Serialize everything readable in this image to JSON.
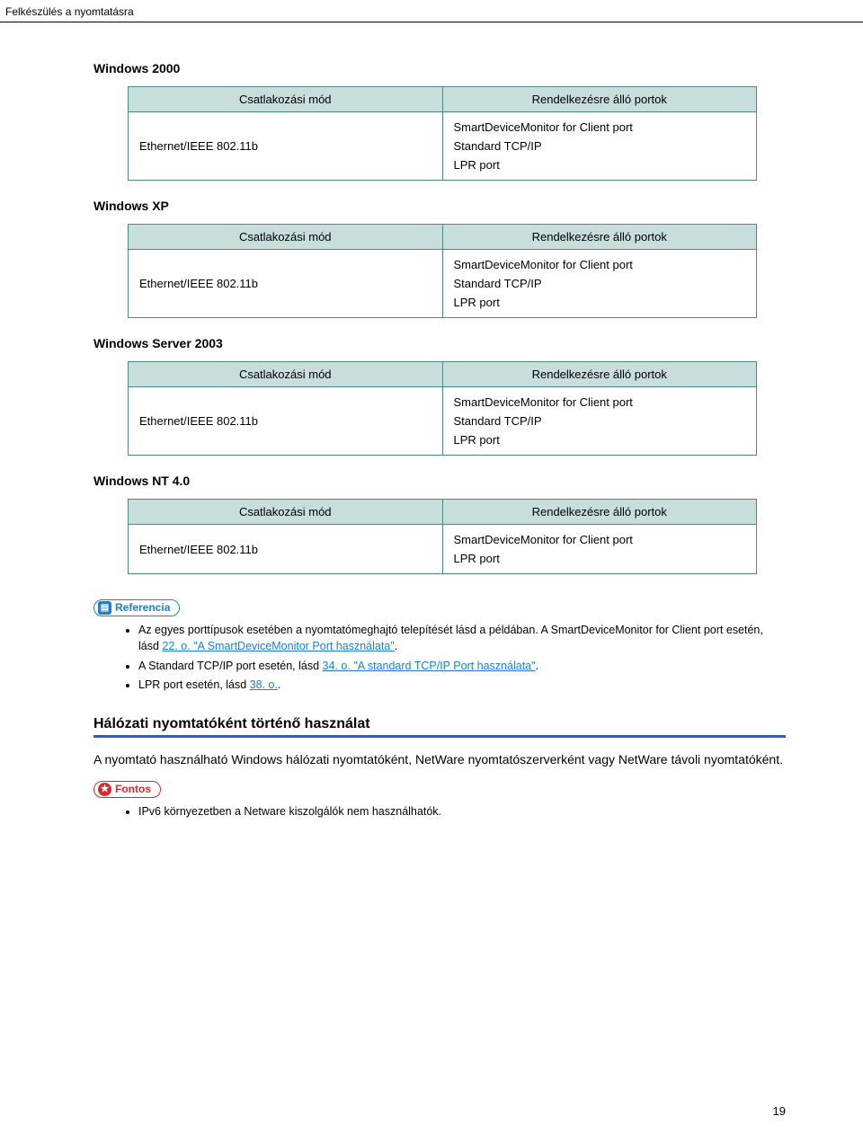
{
  "header": "Felkészülés a nyomtatásra",
  "tables": [
    {
      "title": "Windows 2000",
      "col1": "Csatlakozási mód",
      "col2": "Rendelkezésre álló portok",
      "row_col1": "Ethernet/IEEE 802.11b",
      "row_col2": [
        "SmartDeviceMonitor for Client port",
        "Standard TCP/IP",
        "LPR port"
      ]
    },
    {
      "title": "Windows XP",
      "col1": "Csatlakozási mód",
      "col2": "Rendelkezésre álló portok",
      "row_col1": "Ethernet/IEEE 802.11b",
      "row_col2": [
        "SmartDeviceMonitor for Client port",
        "Standard TCP/IP",
        "LPR port"
      ]
    },
    {
      "title": "Windows Server 2003",
      "col1": "Csatlakozási mód",
      "col2": "Rendelkezésre álló portok",
      "row_col1": "Ethernet/IEEE 802.11b",
      "row_col2": [
        "SmartDeviceMonitor for Client port",
        "Standard TCP/IP",
        "LPR port"
      ]
    },
    {
      "title": "Windows NT 4.0",
      "col1": "Csatlakozási mód",
      "col2": "Rendelkezésre álló portok",
      "row_col1": "Ethernet/IEEE 802.11b",
      "row_col2": [
        "SmartDeviceMonitor for Client port",
        "LPR port"
      ]
    }
  ],
  "referencia": {
    "label": "Referencia",
    "items": {
      "i1a": "Az egyes porttípusok esetében a nyomtatómeghajtó telepítését lásd a példában. A SmartDeviceMonitor for Client port esetén, lásd ",
      "i1link": "22. o. \"A SmartDeviceMonitor Port használata\"",
      "i1b": ".",
      "i2a": "A Standard TCP/IP port esetén, lásd ",
      "i2link": "34. o. \"A standard TCP/IP Port használata\"",
      "i2b": ".",
      "i3a": "LPR port esetén, lásd ",
      "i3link": "38. o.",
      "i3b": "."
    }
  },
  "subhead": "Hálózati nyomtatóként történő használat",
  "body": "A nyomtató használható Windows hálózati nyomtatóként, NetWare nyomtatószerverként vagy NetWare távoli nyomtatóként.",
  "fontos": {
    "label": "Fontos",
    "item": "IPv6 környezetben a Netware kiszolgálók nem használhatók."
  },
  "page": "19"
}
